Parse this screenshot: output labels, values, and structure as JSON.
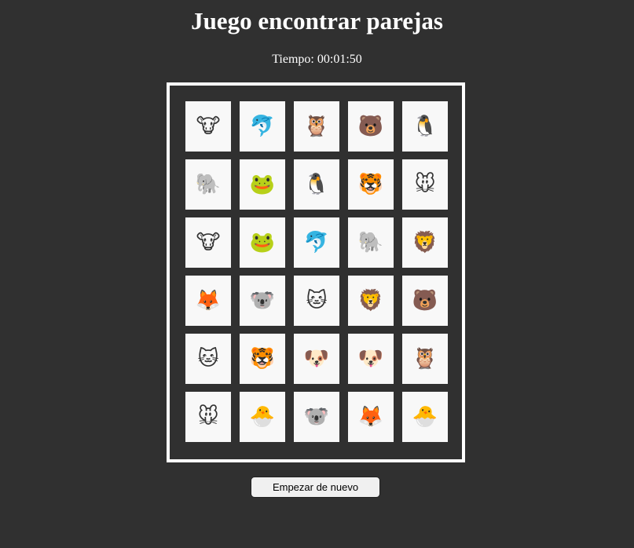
{
  "header": {
    "title": "Juego encontrar parejas",
    "timer_label": "Tiempo: 00:01:50"
  },
  "board": {
    "cards": [
      {
        "animal": "cow",
        "glyph": "🐮",
        "icon": "cow-icon"
      },
      {
        "animal": "dolphin",
        "glyph": "🐬",
        "icon": "dolphin-icon"
      },
      {
        "animal": "owl",
        "glyph": "🦉",
        "icon": "owl-icon"
      },
      {
        "animal": "bear",
        "glyph": "🐻",
        "icon": "bear-icon"
      },
      {
        "animal": "penguin",
        "glyph": "🐧",
        "icon": "penguin-icon"
      },
      {
        "animal": "elephant",
        "glyph": "🐘",
        "icon": "elephant-icon"
      },
      {
        "animal": "frog",
        "glyph": "🐸",
        "icon": "frog-icon"
      },
      {
        "animal": "penguin",
        "glyph": "🐧",
        "icon": "penguin-icon"
      },
      {
        "animal": "tiger",
        "glyph": "🐯",
        "icon": "tiger-icon"
      },
      {
        "animal": "mouse",
        "glyph": "🐭",
        "icon": "mouse-icon"
      },
      {
        "animal": "cow",
        "glyph": "🐮",
        "icon": "cow-icon"
      },
      {
        "animal": "frog",
        "glyph": "🐸",
        "icon": "frog-icon"
      },
      {
        "animal": "dolphin",
        "glyph": "🐬",
        "icon": "dolphin-icon"
      },
      {
        "animal": "elephant",
        "glyph": "🐘",
        "icon": "elephant-icon"
      },
      {
        "animal": "lion",
        "glyph": "🦁",
        "icon": "lion-icon"
      },
      {
        "animal": "fox",
        "glyph": "🦊",
        "icon": "fox-icon"
      },
      {
        "animal": "koala",
        "glyph": "🐨",
        "icon": "koala-icon"
      },
      {
        "animal": "cat",
        "glyph": "🐱",
        "icon": "cat-icon"
      },
      {
        "animal": "lion",
        "glyph": "🦁",
        "icon": "lion-icon"
      },
      {
        "animal": "bear",
        "glyph": "🐻",
        "icon": "bear-icon"
      },
      {
        "animal": "cat",
        "glyph": "🐱",
        "icon": "cat-icon"
      },
      {
        "animal": "tiger",
        "glyph": "🐯",
        "icon": "tiger-icon"
      },
      {
        "animal": "dog",
        "glyph": "🐶",
        "icon": "dog-icon"
      },
      {
        "animal": "dog",
        "glyph": "🐶",
        "icon": "dog-icon"
      },
      {
        "animal": "owl",
        "glyph": "🦉",
        "icon": "owl-icon"
      },
      {
        "animal": "mouse",
        "glyph": "🐭",
        "icon": "mouse-icon"
      },
      {
        "animal": "chick",
        "glyph": "🐣",
        "icon": "hatching-chick-icon"
      },
      {
        "animal": "koala",
        "glyph": "🐨",
        "icon": "koala-icon"
      },
      {
        "animal": "fox",
        "glyph": "🦊",
        "icon": "fox-icon"
      },
      {
        "animal": "chick",
        "glyph": "🐣",
        "icon": "hatching-chick-icon"
      }
    ]
  },
  "controls": {
    "reset_label": "Empezar de nuevo"
  },
  "colors": {
    "background": "#303030",
    "board_border": "#ffffff",
    "card_background": "#f8f8f8"
  }
}
